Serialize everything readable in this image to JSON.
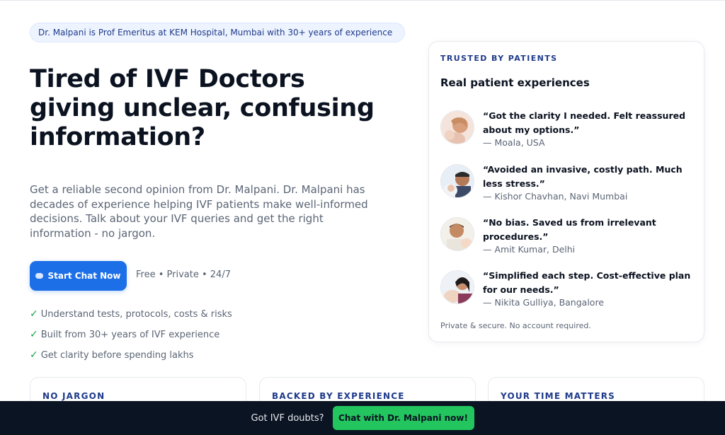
{
  "banner": {
    "text": "Dr. Malpani is Prof Emeritus at KEM Hospital, Mumbai with 30+ years of experience"
  },
  "hero": {
    "title": "Tired of IVF Doctors giving unclear, confusing information?",
    "description": "Get a reliable second opinion from Dr. Malpani. Dr. Malpani has decades of experience helping IVF patients make well-informed decisions. Talk about your IVF queries and get the right information - no jargon.",
    "cta_label": "Start Chat Now",
    "cta_meta": "Free • Private • 24/7",
    "benefits": [
      "Understand tests, protocols, costs & risks",
      "Built from 30+ years of IVF experience",
      "Get clarity before spending lakhs"
    ],
    "check_glyph": "✓"
  },
  "testimonials": {
    "kicker": "TRUSTED BY PATIENTS",
    "title": "Real patient experiences",
    "items": [
      {
        "quote": "“Got the clarity I needed. Felt reassured about my options.”",
        "author": "— Moala, USA"
      },
      {
        "quote": "“Avoided an invasive, costly path. Much less stress.”",
        "author": "— Kishor Chavhan, Navi Mumbai"
      },
      {
        "quote": "“No bias. Saved us from irrelevant procedures.”",
        "author": "— Amit Kumar, Delhi"
      },
      {
        "quote": "“Simplified each step. Cost-effective plan for our needs.”",
        "author": "— Nikita Gulliya, Bangalore"
      }
    ],
    "footer": "Private & secure. No account required."
  },
  "features": [
    {
      "label": "NO JARGON"
    },
    {
      "label": "BACKED BY EXPERIENCE"
    },
    {
      "label": "YOUR TIME MATTERS"
    }
  ],
  "bottom_bar": {
    "question": "Got IVF doubts?",
    "button_label": "Chat with Dr. Malpani now!"
  },
  "colors": {
    "accent": "#1d6fe8",
    "navy": "#1e3a8a",
    "success": "#22c55e",
    "dark_bar": "#0b1422"
  }
}
